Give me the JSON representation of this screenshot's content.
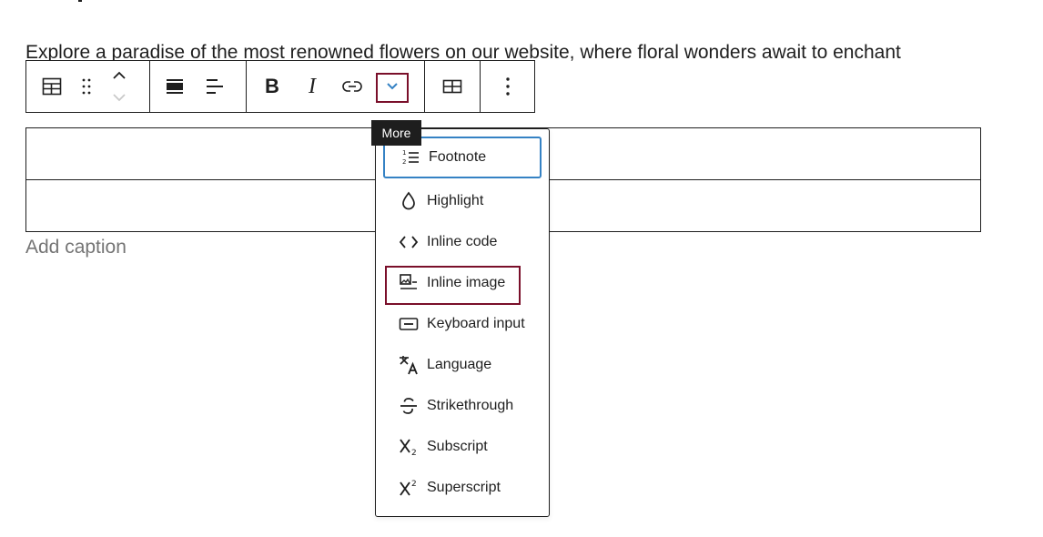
{
  "paragraph": {
    "underlined": "Explore a paradise of the most renowned flowers on our",
    "rest": " website, where floral wonders await to enchant"
  },
  "table": {
    "caption_placeholder": "Add caption"
  },
  "toolbar": {
    "tooltip": "More",
    "buttons": [
      "table-icon",
      "drag-icon",
      "move-icon",
      "align-icon",
      "justify-icon",
      "bold-icon",
      "italic-icon",
      "link-icon",
      "chevron-down-icon",
      "table-edit-icon",
      "options-icon"
    ]
  },
  "menu": {
    "items": [
      {
        "label": "Footnote",
        "icon": "footnote-icon"
      },
      {
        "label": "Highlight",
        "icon": "highlight-icon"
      },
      {
        "label": "Inline code",
        "icon": "code-icon"
      },
      {
        "label": "Inline image",
        "icon": "image-icon"
      },
      {
        "label": "Keyboard input",
        "icon": "keyboard-icon"
      },
      {
        "label": "Language",
        "icon": "language-icon"
      },
      {
        "label": "Strikethrough",
        "icon": "strikethrough-icon"
      },
      {
        "label": "Subscript",
        "icon": "subscript-icon"
      },
      {
        "label": "Superscript",
        "icon": "superscript-icon"
      }
    ]
  },
  "colors": {
    "accent_focus": "#3582c4",
    "highlight_box": "#7a0f2a",
    "chevron": "#3582c4"
  }
}
